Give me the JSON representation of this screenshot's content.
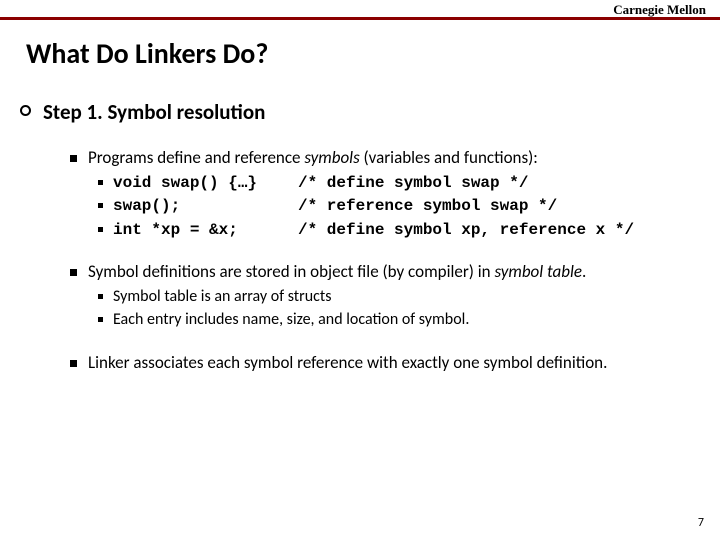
{
  "header": {
    "org": "Carnegie Mellon"
  },
  "title": "What Do Linkers Do?",
  "step": {
    "label": "Step 1. Symbol resolution"
  },
  "b1": {
    "pre": "Programs define and reference ",
    "em": "symbols",
    "post": " (variables and functions):",
    "code": [
      {
        "l": "void swap() {…}",
        "r": "/* define symbol swap */"
      },
      {
        "l": "swap();",
        "r": "/* reference symbol swap */"
      },
      {
        "l": "int *xp = &x;",
        "r": "/* define symbol xp, reference x */"
      }
    ]
  },
  "b2": {
    "pre": "Symbol definitions are stored in object file (by compiler) in ",
    "em": "symbol table",
    "post": ".",
    "sub1": "Symbol table is an array of structs",
    "sub2": "Each entry includes name, size, and location of symbol."
  },
  "b3": {
    "text": "Linker associates each symbol reference with exactly one symbol definition."
  },
  "page": "7"
}
